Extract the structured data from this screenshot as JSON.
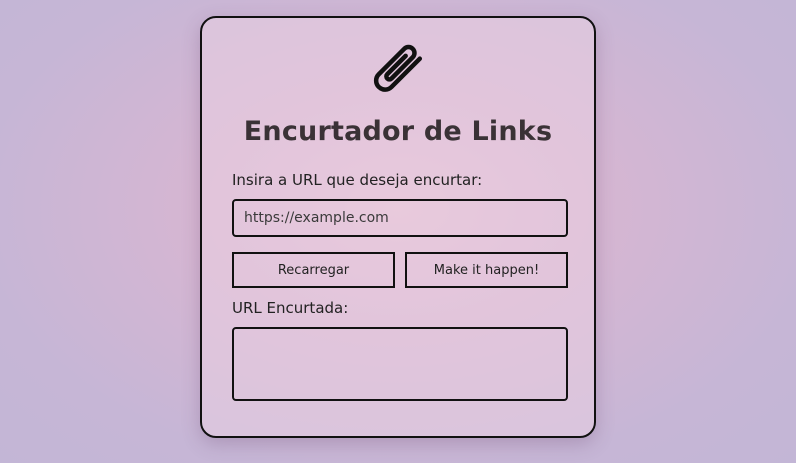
{
  "app": {
    "title": "Encurtador de Links",
    "icon": "paperclip-icon"
  },
  "form": {
    "url_label": "Insira a URL que deseja encurtar:",
    "url_placeholder": "https://example.com",
    "url_value": "",
    "reload_label": "Recarregar",
    "submit_label": "Make it happen!",
    "result_label": "URL Encurtada:",
    "result_value": ""
  },
  "colors": {
    "border": "#111111",
    "title": "#3a3236",
    "background_center": "#e3bfd4",
    "background_edge": "#c3b6d6"
  }
}
